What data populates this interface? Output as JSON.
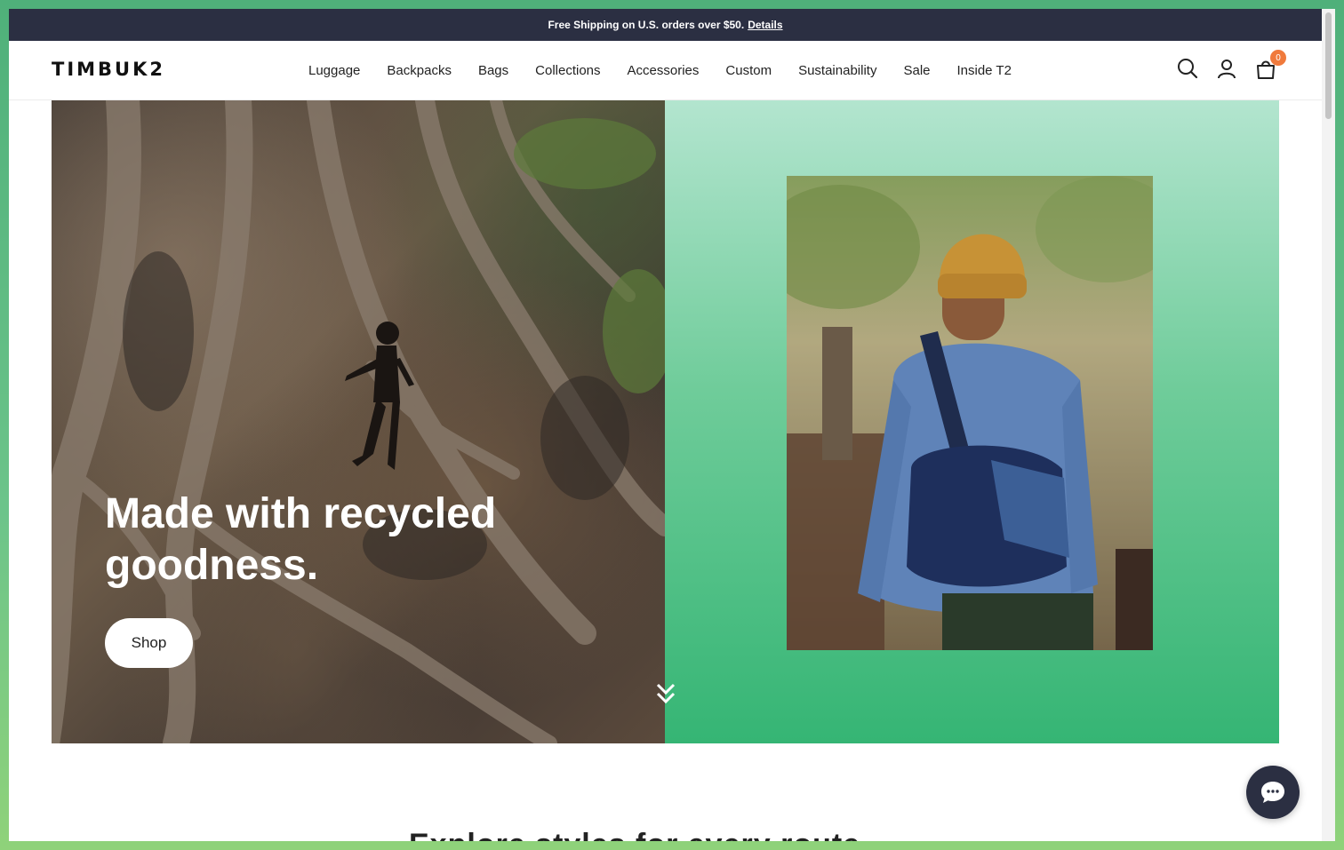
{
  "announcement": {
    "text": "Free Shipping on U.S. orders over $50.",
    "link": "Details"
  },
  "header": {
    "logo": "TIMBUK2",
    "nav": [
      "Luggage",
      "Backpacks",
      "Bags",
      "Collections",
      "Accessories",
      "Custom",
      "Sustainability",
      "Sale",
      "Inside T2"
    ],
    "icons": [
      "search-icon",
      "account-icon",
      "cart-icon"
    ],
    "cart_count": "0"
  },
  "hero": {
    "title_line1": "Made with recycled",
    "title_line2": "goodness.",
    "cta": "Shop"
  },
  "next_section": {
    "heading_peek": "Explore styles for every route"
  },
  "colors": {
    "announcement_bg": "#2b2f42",
    "hero_green": "#35b574",
    "cart_badge": "#f07a3c"
  }
}
